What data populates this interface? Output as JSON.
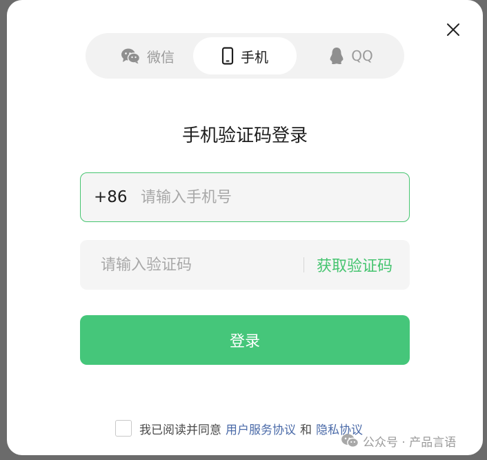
{
  "tabs": [
    {
      "label": "微信",
      "icon": "wechat-icon"
    },
    {
      "label": "手机",
      "icon": "phone-icon",
      "active": true
    },
    {
      "label": "QQ",
      "icon": "qq-penguin-icon"
    }
  ],
  "title": "手机验证码登录",
  "phone": {
    "country_code": "+86",
    "placeholder": "请输入手机号"
  },
  "code": {
    "placeholder": "请输入验证码",
    "get_code_label": "获取验证码"
  },
  "login_label": "登录",
  "agreement": {
    "prefix": "我已阅读并同意",
    "terms_link": "用户服务协议",
    "conjunction": "和",
    "privacy_link": "隐私协议"
  },
  "watermark": {
    "text": "公众号 · 产品言语",
    "icon": "wechat-icon"
  },
  "colors": {
    "accent_green": "#45c46f",
    "button_green": "#45c67a",
    "link_blue": "#4a6aa8",
    "input_bg": "#f5f5f5",
    "tab_bar_bg": "#f2f2f2",
    "overlay_bg": "#6b6b6b"
  }
}
